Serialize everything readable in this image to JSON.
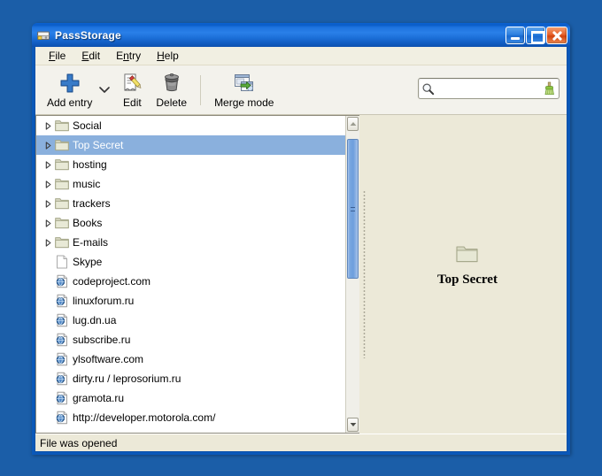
{
  "window": {
    "title": "PassStorage",
    "icon": "safe-storage-icon",
    "controls": {
      "minimize": "Minimize",
      "maximize": "Maximize",
      "close": "Close"
    }
  },
  "menubar": [
    {
      "label": "File",
      "mnemonic": "F"
    },
    {
      "label": "Edit",
      "mnemonic": "E"
    },
    {
      "label": "Entry",
      "mnemonic": "n"
    },
    {
      "label": "Help",
      "mnemonic": "H"
    }
  ],
  "toolbar": {
    "add_entry_label": "Add entry",
    "add_entry_icon": "plus-icon",
    "dropdown_icon": "chevron-down-icon",
    "edit_label": "Edit",
    "edit_icon": "pencil-note-icon",
    "delete_label": "Delete",
    "delete_icon": "trash-can-icon",
    "merge_label": "Merge mode",
    "merge_icon": "merge-windows-icon"
  },
  "search": {
    "value": "",
    "placeholder": "",
    "search_icon": "magnifier-icon",
    "clear_icon": "broom-icon"
  },
  "tree": {
    "rows": [
      {
        "label": "Social",
        "icon": "folder-icon",
        "expandable": true,
        "selected": false
      },
      {
        "label": "Top Secret",
        "icon": "folder-icon",
        "expandable": true,
        "selected": true
      },
      {
        "label": "hosting",
        "icon": "folder-icon",
        "expandable": true,
        "selected": false
      },
      {
        "label": "music",
        "icon": "folder-icon",
        "expandable": true,
        "selected": false
      },
      {
        "label": "trackers",
        "icon": "folder-icon",
        "expandable": true,
        "selected": false
      },
      {
        "label": "Books",
        "icon": "folder-icon",
        "expandable": true,
        "selected": false
      },
      {
        "label": "E-mails",
        "icon": "folder-icon",
        "expandable": true,
        "selected": false
      },
      {
        "label": "Skype",
        "icon": "page-icon",
        "expandable": false,
        "selected": false
      },
      {
        "label": "codeproject.com",
        "icon": "web-page-icon",
        "expandable": false,
        "selected": false
      },
      {
        "label": "linuxforum.ru",
        "icon": "web-page-icon",
        "expandable": false,
        "selected": false
      },
      {
        "label": "lug.dn.ua",
        "icon": "web-page-icon",
        "expandable": false,
        "selected": false
      },
      {
        "label": "subscribe.ru",
        "icon": "web-page-icon",
        "expandable": false,
        "selected": false
      },
      {
        "label": "ylsoftware.com",
        "icon": "web-page-icon",
        "expandable": false,
        "selected": false
      },
      {
        "label": "dirty.ru / leprosorium.ru",
        "icon": "web-page-icon",
        "expandable": false,
        "selected": false
      },
      {
        "label": "gramota.ru",
        "icon": "web-page-icon",
        "expandable": false,
        "selected": false
      },
      {
        "label": "http://developer.motorola.com/",
        "icon": "web-page-icon",
        "expandable": false,
        "selected": false
      }
    ],
    "scrollbar": {
      "up_icon": "scroll-up-arrow-icon",
      "down_icon": "scroll-down-arrow-icon"
    }
  },
  "detail": {
    "icon": "folder-icon",
    "title": "Top Secret"
  },
  "statusbar": {
    "text": "File was opened"
  },
  "colors": {
    "desktop": "#1b5ea8",
    "titlebar": "#2a80e8",
    "selection": "#8ab0dd",
    "client": "#ece9d8",
    "accent_plus": "#2f6fba"
  }
}
